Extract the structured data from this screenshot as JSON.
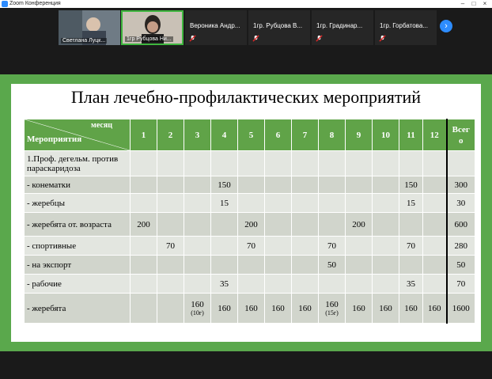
{
  "window": {
    "title": "Zoom Конференция"
  },
  "participants": [
    {
      "name": "Светлана Луцк...",
      "video": true,
      "active": false
    },
    {
      "name": "1гр Рубцова Ни...",
      "video": true,
      "active": true
    },
    {
      "name": "Вероника Андр...",
      "video": false,
      "muted": true
    },
    {
      "name": "1гр. Рубцова В...",
      "video": false,
      "muted": true
    },
    {
      "name": "1гр. Градинар...",
      "video": false,
      "muted": true
    },
    {
      "name": "1гр. Горбатова...",
      "video": false,
      "muted": true
    }
  ],
  "slide": {
    "title": "План лечебно-профилактических мероприятий",
    "header": {
      "month_label": "месяц",
      "activity_label": "Мероприятия",
      "months": [
        "1",
        "2",
        "3",
        "4",
        "5",
        "6",
        "7",
        "8",
        "9",
        "10",
        "11",
        "12"
      ],
      "total_label": "Всег о"
    },
    "rows": [
      {
        "label": "1.Проф. дегельм. против параскаридоза",
        "values": [
          "",
          "",
          "",
          "",
          "",
          "",
          "",
          "",
          "",
          "",
          "",
          ""
        ],
        "total": ""
      },
      {
        "label": "- конематки",
        "values": [
          "",
          "",
          "",
          "150",
          "",
          "",
          "",
          "",
          "",
          "",
          "150",
          ""
        ],
        "total": "300"
      },
      {
        "label": "- жеребцы",
        "values": [
          "",
          "",
          "",
          "15",
          "",
          "",
          "",
          "",
          "",
          "",
          "15",
          ""
        ],
        "total": "30"
      },
      {
        "label": "- жеребята от. возраста",
        "values": [
          "200",
          "",
          "",
          "",
          "200",
          "",
          "",
          "",
          "200",
          "",
          "",
          ""
        ],
        "total": "600"
      },
      {
        "label": "- спортивные",
        "values": [
          "",
          "70",
          "",
          "",
          "70",
          "",
          "",
          "70",
          "",
          "",
          "70",
          ""
        ],
        "total": "280"
      },
      {
        "label": "- на экспорт",
        "values": [
          "",
          "",
          "",
          "",
          "",
          "",
          "",
          "50",
          "",
          "",
          "",
          ""
        ],
        "total": "50"
      },
      {
        "label": "- рабочие",
        "values": [
          "",
          "",
          "",
          "35",
          "",
          "",
          "",
          "",
          "",
          "",
          "35",
          ""
        ],
        "total": "70"
      },
      {
        "label": "- жеребята",
        "values": [
          "",
          "",
          "160",
          "160",
          "160",
          "160",
          "160",
          "160",
          "160",
          "160",
          "160",
          "160"
        ],
        "notes": [
          "",
          "",
          "(10г)",
          "",
          "",
          "",
          "",
          "(15г)",
          "",
          "",
          "",
          ""
        ],
        "total": "1600"
      }
    ]
  }
}
